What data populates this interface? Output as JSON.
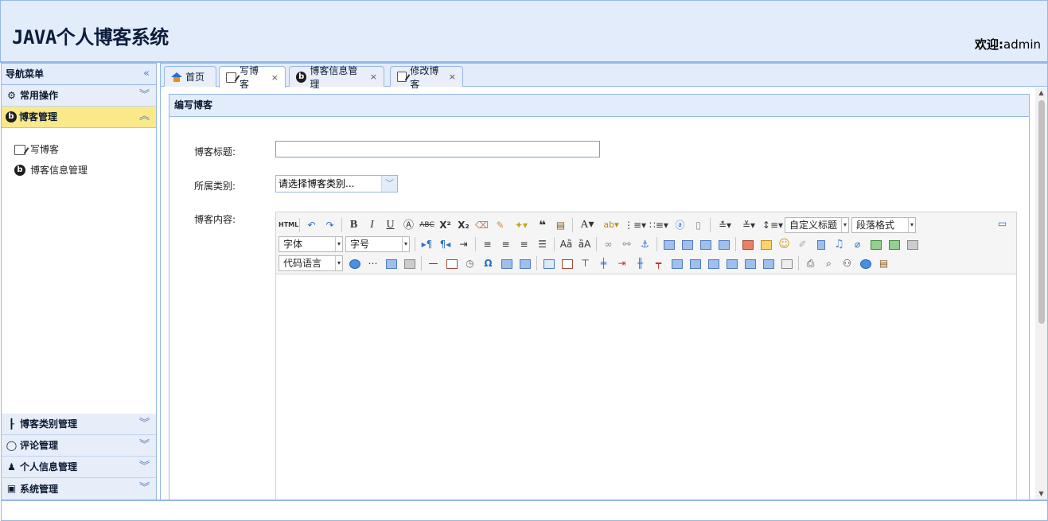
{
  "header": {
    "title": "JAVA个人博客系统",
    "welcome_label": "欢迎:",
    "user": "admin"
  },
  "nav": {
    "title": "导航菜单",
    "collapse_icon": "double-chevron-left-icon",
    "sections": [
      {
        "label": "常用操作",
        "icon": "gear-icon",
        "state": "collapsed"
      },
      {
        "label": "博客管理",
        "icon": "b-circle-icon",
        "state": "expanded"
      },
      {
        "label": "博客类别管理",
        "icon": "tree-icon",
        "state": "collapsed"
      },
      {
        "label": "评论管理",
        "icon": "speech-bubble-icon",
        "state": "collapsed"
      },
      {
        "label": "个人信息管理",
        "icon": "user-icon",
        "state": "collapsed"
      },
      {
        "label": "系统管理",
        "icon": "settings-icon",
        "state": "collapsed"
      }
    ],
    "blog_items": [
      {
        "label": "写博客",
        "icon": "edit-icon"
      },
      {
        "label": "博客信息管理",
        "icon": "b-circle-icon"
      }
    ]
  },
  "tabs": [
    {
      "label": "首页",
      "icon": "home-icon",
      "closable": false
    },
    {
      "label": "写博客",
      "icon": "edit-icon",
      "closable": true,
      "selected": true
    },
    {
      "label": "博客信息管理",
      "icon": "b-circle-icon",
      "closable": true
    },
    {
      "label": "修改博客",
      "icon": "edit-icon",
      "closable": true
    }
  ],
  "tab_close_glyph": "×",
  "form": {
    "panel_title": "编写博客",
    "title_label": "博客标题:",
    "title_value": "",
    "category_label": "所属类别:",
    "category_value": "请选择博客类别...",
    "content_label": "博客内容:"
  },
  "editor": {
    "custom_heading": "自定义标题",
    "paragraph_format": "段落格式",
    "font_family": "字体",
    "font_size": "字号",
    "code_language": "代码语言"
  }
}
